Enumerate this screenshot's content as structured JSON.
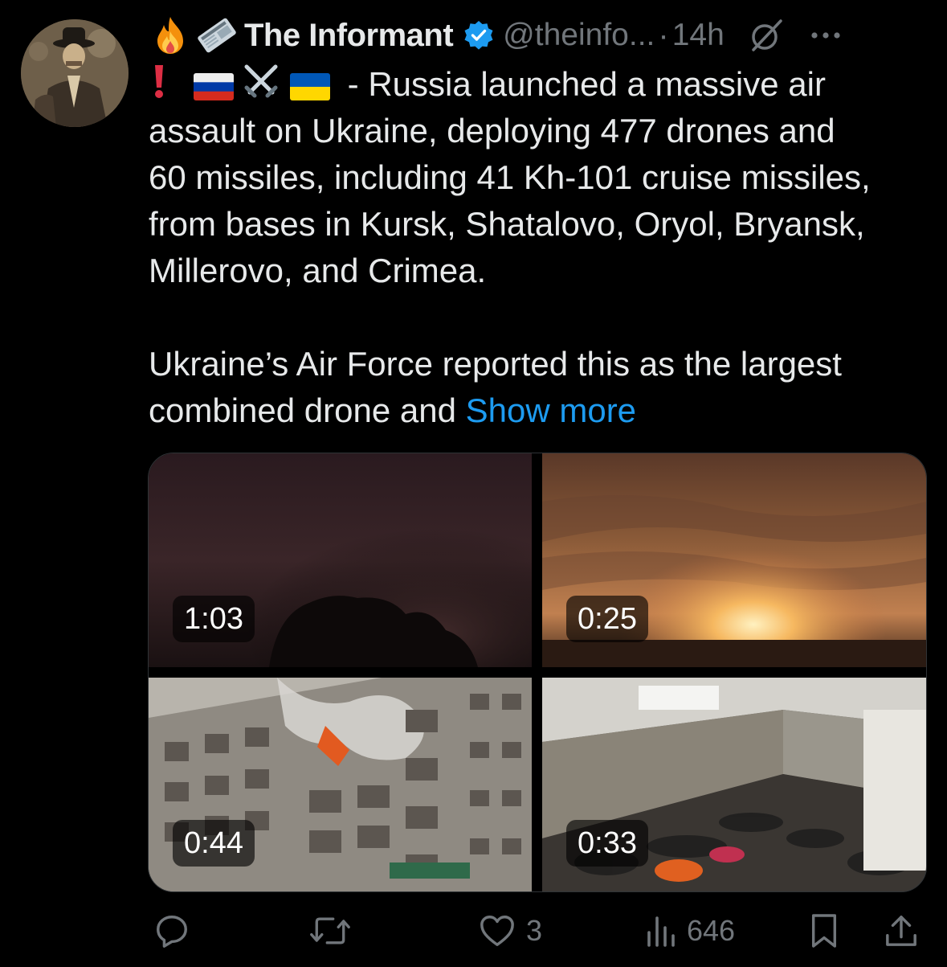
{
  "tweet": {
    "author": {
      "display_name": "The Informant",
      "handle": "@theinfo...",
      "verified": true,
      "avatar_icon": "avatar-portrait"
    },
    "time_separator": "·",
    "time": "14h",
    "header_emojis": [
      "fire-emoji",
      "newspaper-emoji"
    ],
    "text_prefix_emojis": [
      "red-exclamation-emoji",
      "russia-flag-emoji",
      "crossed-swords-emoji",
      "ukraine-flag-emoji"
    ],
    "text_lines": [
      " - Russia launched a massive air",
      "assault on Ukraine, deploying 477 drones and",
      "60 missiles, including 41 Kh-101 cruise missiles,",
      "from bases in Kursk, Shatalovo, Oryol, Bryansk,",
      "Millerovo, and Crimea.",
      "Ukraine’s Air Force reported this as the largest",
      "combined drone and "
    ],
    "show_more_label": "Show more",
    "media": [
      {
        "type": "video",
        "duration": "1:03"
      },
      {
        "type": "video",
        "duration": "0:25"
      },
      {
        "type": "video",
        "duration": "0:44"
      },
      {
        "type": "video",
        "duration": "0:33"
      }
    ],
    "actions": {
      "reply": {
        "icon": "reply-icon",
        "count": ""
      },
      "retweet": {
        "icon": "retweet-icon",
        "count": ""
      },
      "like": {
        "icon": "heart-icon",
        "count": "3"
      },
      "views": {
        "icon": "views-icon",
        "count": "646"
      },
      "bookmark": {
        "icon": "bookmark-icon"
      },
      "share": {
        "icon": "share-icon"
      }
    }
  },
  "colors": {
    "background": "#000000",
    "text": "#e7e9ea",
    "muted": "#71767b",
    "link": "#1d9bf0",
    "verified": "#1d9bf0"
  }
}
